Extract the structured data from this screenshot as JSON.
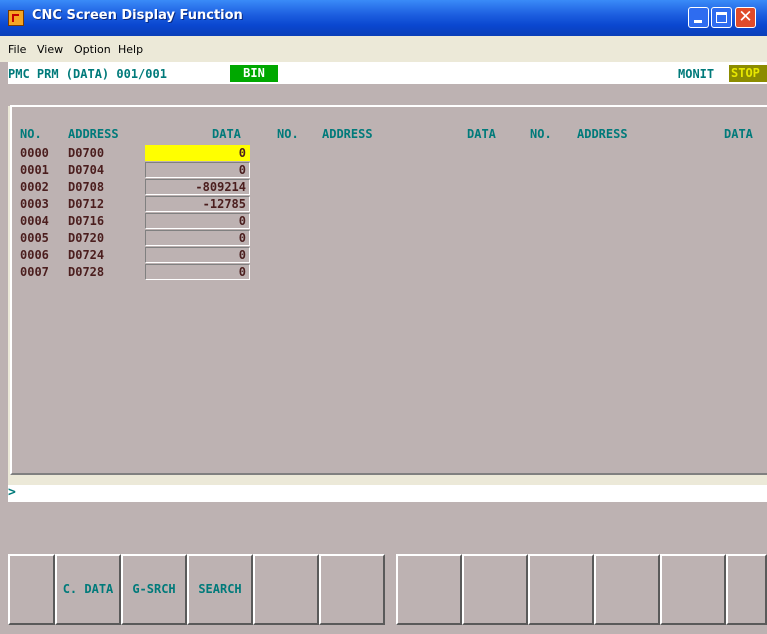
{
  "window": {
    "title": "CNC Screen Display Function",
    "icon": "app-icon",
    "controls": [
      "minimize",
      "maximize",
      "close"
    ]
  },
  "menu": {
    "items": [
      "File",
      "View",
      "Option",
      "Help"
    ]
  },
  "status": {
    "screen": "PMC PRM (DATA) 001/001",
    "format": "BIN",
    "mode": "MONIT",
    "state": "STOP"
  },
  "table": {
    "headers": [
      "NO.",
      "ADDRESS",
      "DATA",
      "NO.",
      "ADDRESS",
      "DATA",
      "NO.",
      "ADDRESS",
      "DATA"
    ],
    "rows": [
      {
        "no": "0000",
        "address": "D0700",
        "data": "0"
      },
      {
        "no": "0001",
        "address": "D0704",
        "data": "0"
      },
      {
        "no": "0002",
        "address": "D0708",
        "data": "-809214"
      },
      {
        "no": "0003",
        "address": "D0712",
        "data": "-12785"
      },
      {
        "no": "0004",
        "address": "D0716",
        "data": "0"
      },
      {
        "no": "0005",
        "address": "D0720",
        "data": "0"
      },
      {
        "no": "0006",
        "address": "D0724",
        "data": "0"
      },
      {
        "no": "0007",
        "address": "D0728",
        "data": "0"
      }
    ]
  },
  "input": {
    "prompt": ">",
    "value": ""
  },
  "softkeys": [
    "",
    "C. DATA",
    "G-SRCH",
    "SEARCH",
    "",
    "",
    "",
    "",
    "",
    "",
    "",
    ""
  ],
  "colors": {
    "panel_bg": "#BDB2B2",
    "label_text": "#007A7A",
    "data_text": "#4B1E1E",
    "cursor": "#FFFF00",
    "bin_badge": "#00A800",
    "stop_badge": "#8C8C00"
  }
}
